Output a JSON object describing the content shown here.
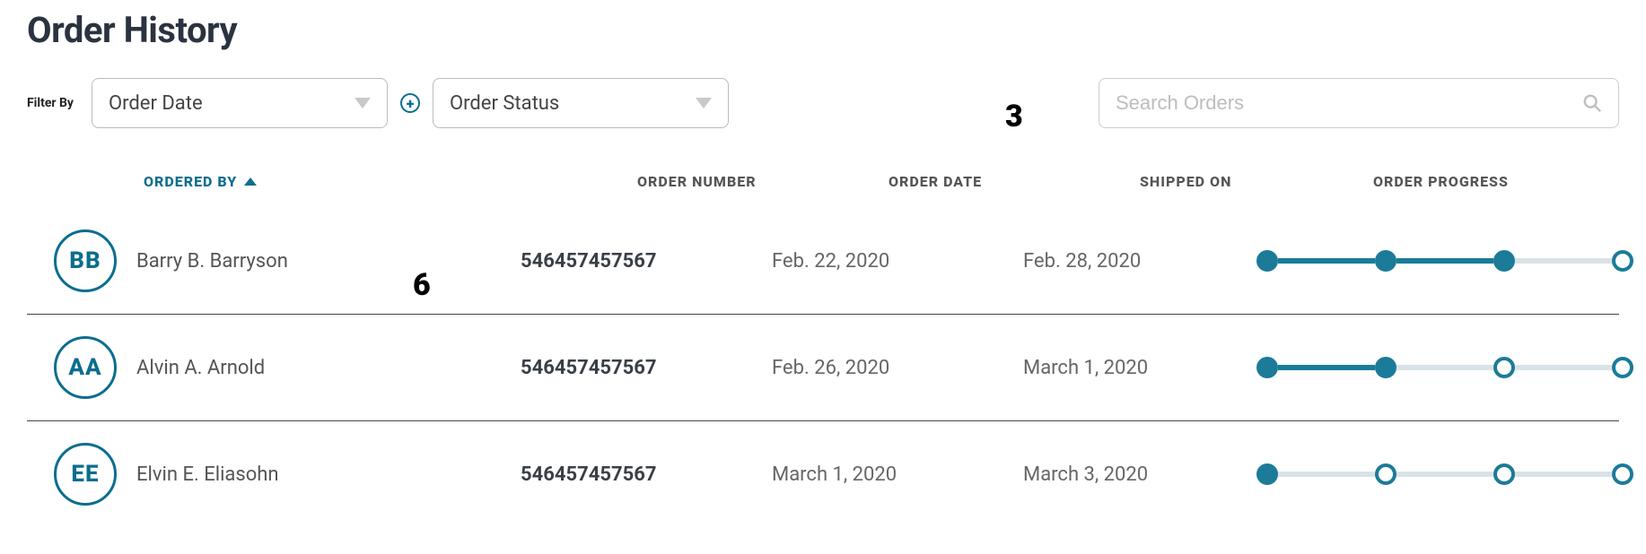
{
  "page": {
    "title": "Order History"
  },
  "filters": {
    "label": "Filter By",
    "dropdown1": "Order Date",
    "dropdown2": "Order Status"
  },
  "search": {
    "placeholder": "Search Orders"
  },
  "markers": {
    "m3": "3",
    "m6": "6"
  },
  "columns": {
    "c1": "Ordered By",
    "c2": "Order Number",
    "c3": "Order Date",
    "c4": "Shipped On",
    "c5": "Order Progress"
  },
  "rows": [
    {
      "initials": "BB",
      "name": "Barry B. Barryson",
      "orderNumber": "546457457567",
      "orderDate": "Feb. 22, 2020",
      "shippedOn": "Feb. 28, 2020",
      "progress": 3
    },
    {
      "initials": "AA",
      "name": "Alvin A. Arnold",
      "orderNumber": "546457457567",
      "orderDate": "Feb. 26, 2020",
      "shippedOn": "March 1, 2020",
      "progress": 2
    },
    {
      "initials": "EE",
      "name": "Elvin E. Eliasohn",
      "orderNumber": "546457457567",
      "orderDate": "March 1, 2020",
      "shippedOn": "March 3, 2020",
      "progress": 1
    }
  ]
}
